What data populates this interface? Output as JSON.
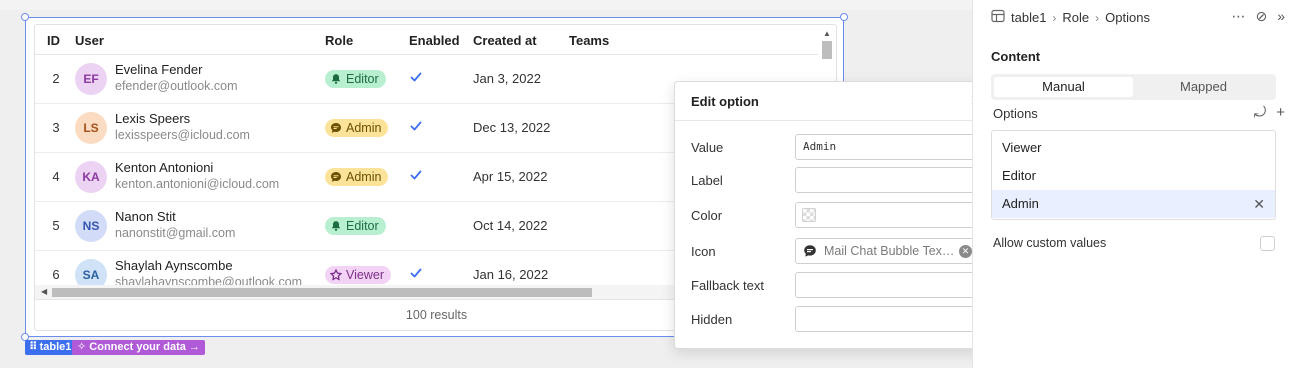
{
  "table": {
    "name": "table1",
    "columns": [
      "ID",
      "User",
      "Role",
      "Enabled",
      "Created at",
      "Teams"
    ],
    "rows": [
      {
        "id": "2",
        "initials": "EF",
        "name": "Evelina Fender",
        "email": "efender@outlook.com",
        "role": "Editor",
        "enabled": true,
        "created": "Jan 3, 2022",
        "avatar_bg": "#ecd2f3",
        "avatar_fg": "#8a3aa0"
      },
      {
        "id": "3",
        "initials": "LS",
        "name": "Lexis Speers",
        "email": "lexisspeers@icloud.com",
        "role": "Admin",
        "enabled": true,
        "created": "Dec 13, 2022",
        "avatar_bg": "#fbdcc2",
        "avatar_fg": "#a4501a"
      },
      {
        "id": "4",
        "initials": "KA",
        "name": "Kenton Antonioni",
        "email": "kenton.antonioni@icloud.com",
        "role": "Admin",
        "enabled": true,
        "created": "Apr 15, 2022",
        "avatar_bg": "#ecd2f3",
        "avatar_fg": "#8a3aa0"
      },
      {
        "id": "5",
        "initials": "NS",
        "name": "Nanon Stit",
        "email": "nanonstit@gmail.com",
        "role": "Editor",
        "enabled": false,
        "created": "Oct 14, 2022",
        "avatar_bg": "#d2dcf8",
        "avatar_fg": "#3554b0"
      },
      {
        "id": "6",
        "initials": "SA",
        "name": "Shaylah Aynscombe",
        "email": "shaylahaynscombe@outlook.com",
        "role": "Viewer",
        "enabled": true,
        "created": "Jan 16, 2022",
        "avatar_bg": "#cfe2f8",
        "avatar_fg": "#2b5fa0"
      }
    ],
    "results": "100 results",
    "tag_label": "table1",
    "connect_label": "Connect your data →"
  },
  "role_styles": {
    "Editor": {
      "bg": "#b8efd0",
      "fg": "#1d6b40",
      "icon": "bell-icon"
    },
    "Admin": {
      "bg": "#fde39a",
      "fg": "#6b5000",
      "icon": "chat-bubble-icon"
    },
    "Viewer": {
      "bg": "#f3d3f5",
      "fg": "#7b2f86",
      "icon": "star-icon"
    }
  },
  "popover": {
    "title": "Edit option",
    "fields": {
      "value_label": "Value",
      "value": "Admin",
      "label_label": "Label",
      "color_label": "Color",
      "icon_label": "Icon",
      "icon_value": "Mail Chat Bubble Tex…",
      "fallback_label": "Fallback text",
      "hidden_label": "Hidden"
    }
  },
  "panel": {
    "breadcrumb": [
      "table1",
      "Role",
      "Options"
    ],
    "section": "Content",
    "segments": [
      "Manual",
      "Mapped"
    ],
    "active_segment": "Manual",
    "options_label": "Options",
    "options": [
      "Viewer",
      "Editor",
      "Admin"
    ],
    "selected_option": "Admin",
    "custom_values_label": "Allow custom values"
  },
  "colors": {
    "accent": "#3c6ef0",
    "check": "#3c6ef0",
    "connect": "#b05ad8"
  }
}
